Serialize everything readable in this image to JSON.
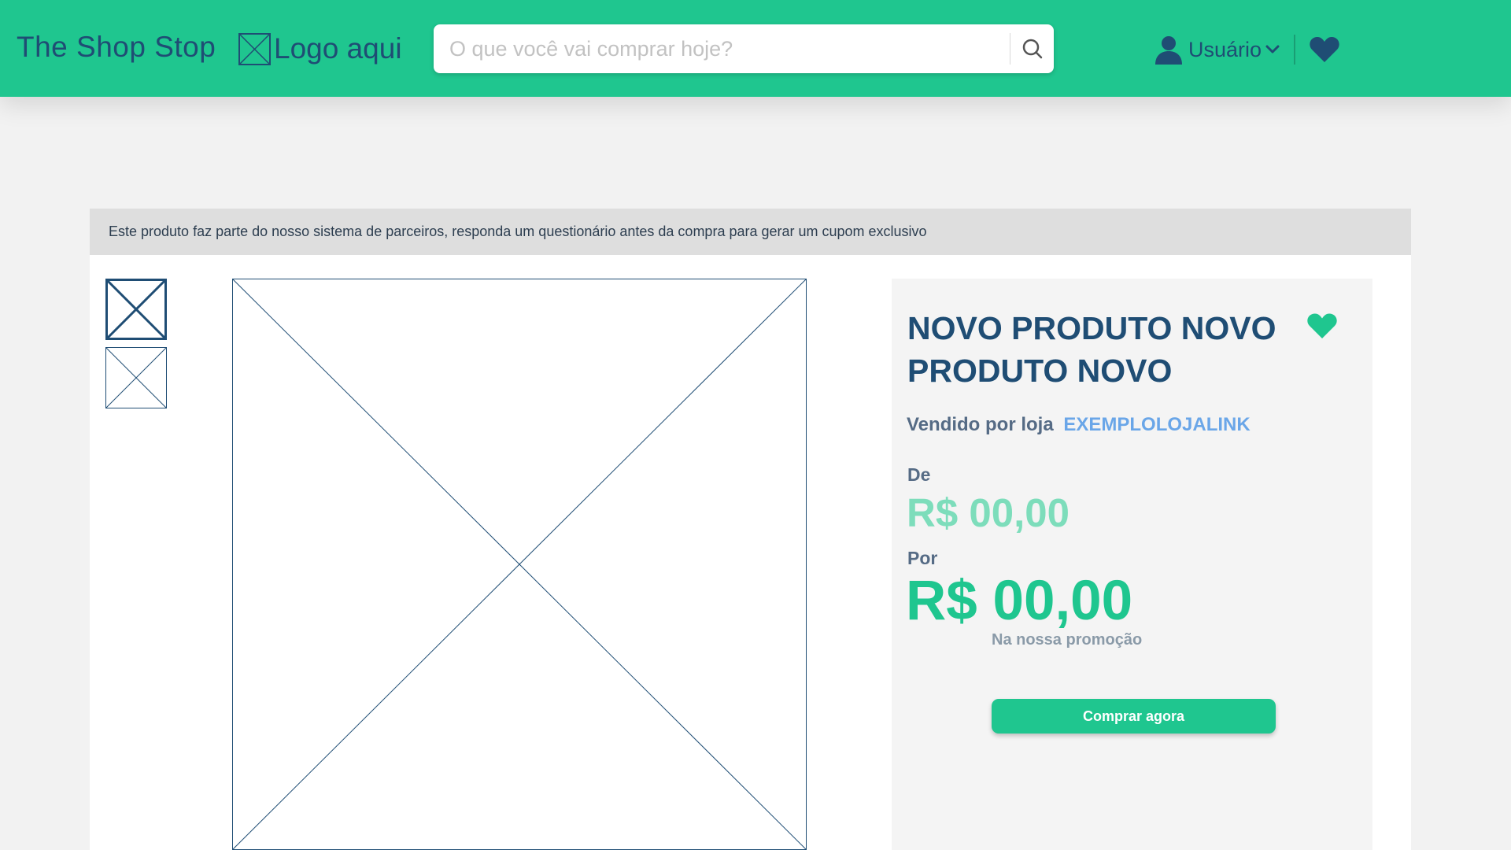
{
  "header": {
    "brand": "The Shop Stop",
    "logo_text": "Logo aqui",
    "search_placeholder": "O que você vai comprar hoje?",
    "user_label": "Usuário"
  },
  "notice": {
    "text": "Este produto faz parte do nosso sistema de parceiros, responda um questionário antes da compra para gerar um cupom exclusivo"
  },
  "product": {
    "title": "NOVO PRODUTO NOVO PRODUTO NOVO",
    "seller_prefix": "Vendido por loja",
    "seller_link": "EXEMPLOLOJALINK",
    "from_label": "De",
    "old_price": "R$ 00,00",
    "for_label": "Por",
    "new_price": "R$ 00,00",
    "promo_note": "Na nossa promoção",
    "buy_label": "Comprar agora"
  },
  "colors": {
    "primary": "#1fc68f",
    "navy": "#1f4d74",
    "link": "#6aa6e8"
  },
  "icons": [
    "image-placeholder-icon",
    "search-icon",
    "user-icon",
    "chevron-down-icon",
    "heart-icon"
  ]
}
